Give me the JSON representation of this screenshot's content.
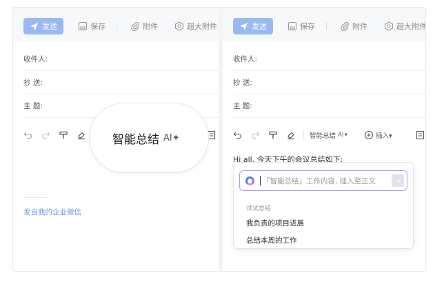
{
  "toolbar": {
    "send": "发送",
    "save": "保存",
    "attach": "附件",
    "big_attach": "超大附件"
  },
  "fields": {
    "to": "收件人:",
    "cc": "抄  送:",
    "subject": "主  题:"
  },
  "editor": {
    "ai_summary": "智能总结",
    "ai_badge": "AI✦",
    "insert": "插入▾"
  },
  "left": {
    "wecom_link": "发自我的企业微信"
  },
  "right": {
    "body_text": "Hi all,  今天下午的会议总结如下:"
  },
  "ai_popup": {
    "placeholder": "「智能总结」工作内容, 插入至正文",
    "submit_icon": "→",
    "suggest_label": "试试总结",
    "suggestions": [
      "我负责的项目进展",
      "总结本周的工作"
    ]
  },
  "colors": {
    "accent": "#9ab8f2",
    "link": "#6a98e8",
    "ai_border": "#b69ae8"
  }
}
